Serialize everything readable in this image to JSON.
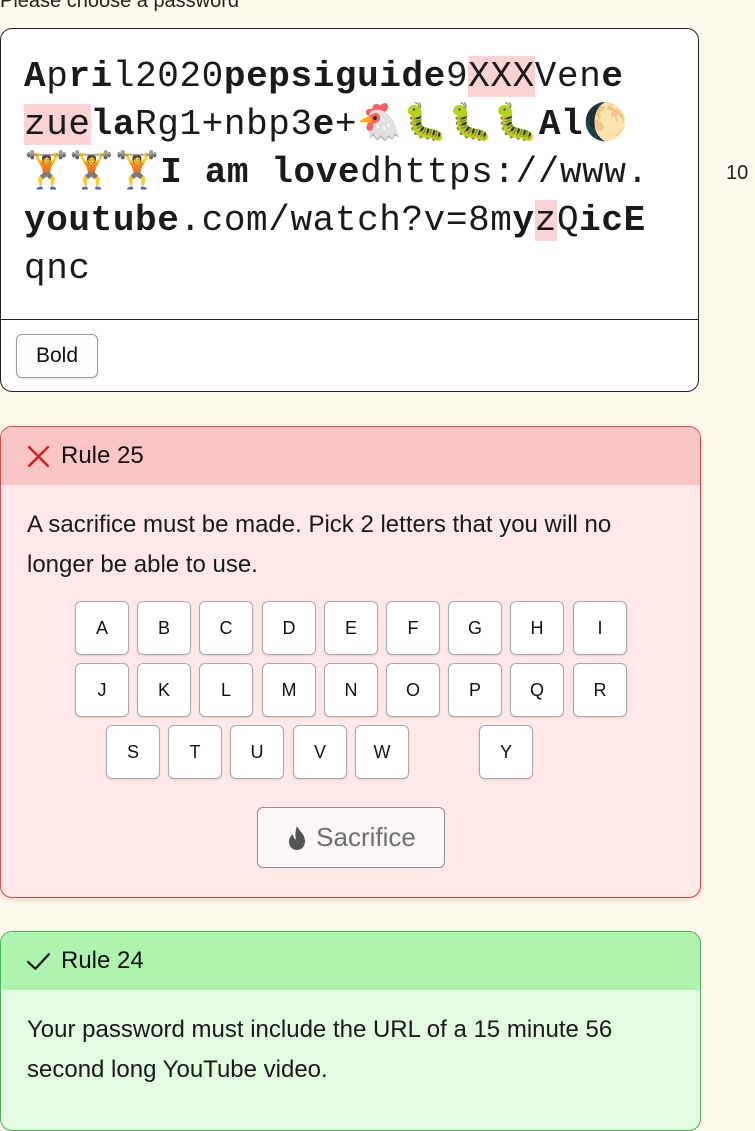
{
  "prompt": "Please choose a password",
  "char_count": "10",
  "password": {
    "segments": [
      {
        "text": "A",
        "bold": true
      },
      {
        "text": "p",
        "bold": false
      },
      {
        "text": "ri",
        "bold": true
      },
      {
        "text": "l2020",
        "bold": false
      },
      {
        "text": "pepsiguide",
        "bold": true
      },
      {
        "text": "9",
        "bold": false
      },
      {
        "text": "XXX",
        "bold": false,
        "highlight": true
      },
      {
        "text": "Ven",
        "bold": false
      },
      {
        "text": "e",
        "bold": true
      },
      {
        "text": "zue",
        "bold": false,
        "highlight": true
      },
      {
        "text": "la",
        "bold": true
      },
      {
        "text": "Rg1+nbp3",
        "bold": false
      },
      {
        "text": "e",
        "bold": true
      },
      {
        "text": "+🐔🐛🐛🐛",
        "bold": false
      },
      {
        "text": "Al",
        "bold": true
      },
      {
        "text": "🌔",
        "bold": false
      },
      {
        "text": "🏋️🏋️🏋️",
        "bold": false
      },
      {
        "text": "I am ",
        "bold": true
      },
      {
        "text": "love",
        "bold": true
      },
      {
        "text": "dhttps://www.",
        "bold": false
      },
      {
        "text": "youtube",
        "bold": true
      },
      {
        "text": ".com/watch?v=8m",
        "bold": false
      },
      {
        "text": "y",
        "bold": true
      },
      {
        "text": "z",
        "bold": false,
        "highlight": true
      },
      {
        "text": "Q",
        "bold": false
      },
      {
        "text": "ic",
        "bold": true
      },
      {
        "text": "E",
        "bold": true
      },
      {
        "text": "qnc",
        "bold": false
      }
    ]
  },
  "toolbar": {
    "bold_label": "Bold"
  },
  "rule25": {
    "title": "Rule 25",
    "status": "failed",
    "description": "A sacrifice must be made. Pick 2 letters that you will no longer be able to use.",
    "letters": [
      "A",
      "B",
      "C",
      "D",
      "E",
      "F",
      "G",
      "H",
      "I",
      "J",
      "K",
      "L",
      "M",
      "N",
      "O",
      "P",
      "Q",
      "R",
      "S",
      "T",
      "U",
      "V",
      "W",
      "Y"
    ],
    "button_label": "Sacrifice"
  },
  "rule24": {
    "title": "Rule 24",
    "status": "passed",
    "description": "Your password must include the URL of a 15 minute 56 second long YouTube video."
  },
  "colors": {
    "page_bg": "#fdf9ec",
    "fail_border": "#d94a4a",
    "fail_header": "#fcc5c5",
    "fail_body": "#fee8e8",
    "pass_border": "#4fae5a",
    "pass_header": "#aef3ae",
    "pass_body": "#e3fbe1",
    "highlight": "#fbd3d3"
  }
}
